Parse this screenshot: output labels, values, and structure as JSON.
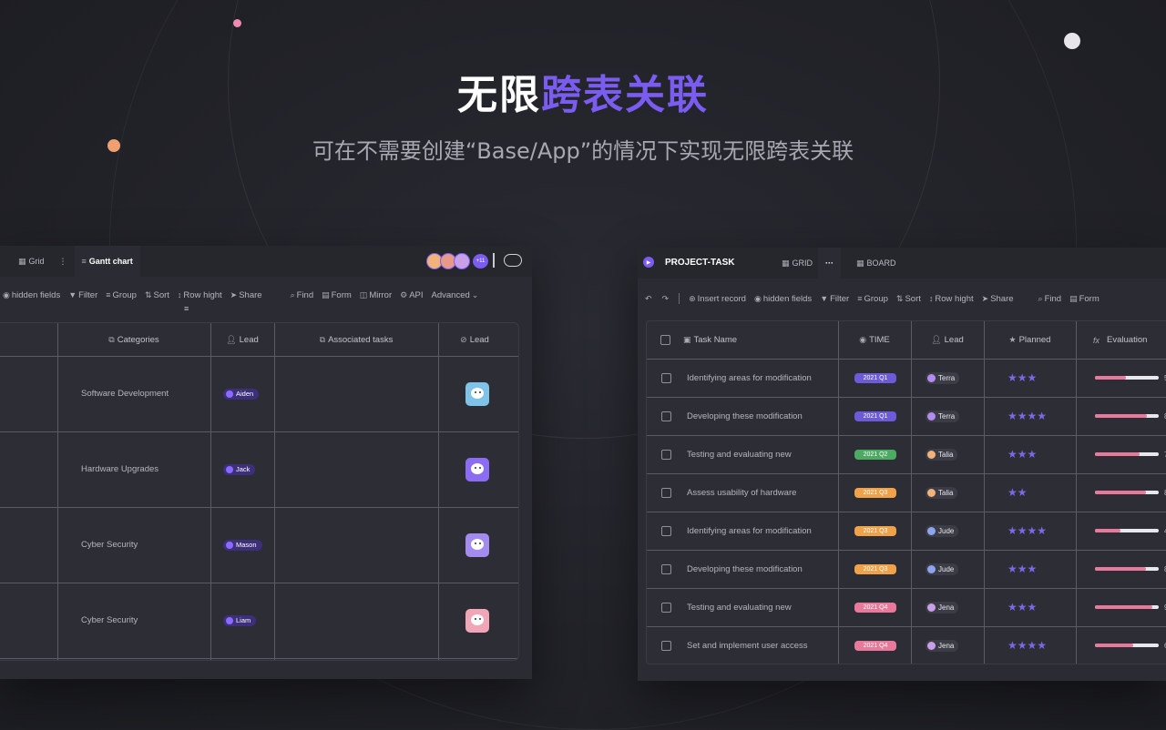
{
  "hero": {
    "title_white": "无限",
    "title_purple": "跨表关联",
    "subtitle": "可在不需要创建“Base/App”的情况下实现无限跨表关联"
  },
  "colors": {
    "accent": "#7b5cf0",
    "bg": "#222329",
    "panel": "#2b2c33",
    "star": "#7b67e8",
    "progress": "#e8799a"
  },
  "left": {
    "tabs": {
      "grid": "Grid",
      "more": "⋮",
      "gantt": "Gantt chart"
    },
    "avatar_count": "+11",
    "toolbar": {
      "hidden": "hidden fields",
      "filter": "Filter",
      "group": "Group",
      "sort": "Sort",
      "row_height": "Row hight",
      "share": "Share",
      "find": "Find",
      "form": "Form",
      "mirror": "Mirror",
      "api": "API",
      "advanced": "Advanced"
    },
    "columns": {
      "categories": "Categories",
      "lead": "Lead",
      "assoc": "Associated tasks",
      "lead2": "Lead"
    },
    "rows": [
      {
        "category": "Software Development",
        "lead": "Aiden",
        "tile": "#7fc3e8"
      },
      {
        "category": "Hardware Upgrades",
        "lead": "Jack",
        "tile": "#8b6cf2"
      },
      {
        "category": "Cyber Security",
        "lead": "Mason",
        "tile": "#a38bf0"
      },
      {
        "category": "Cyber Security",
        "lead": "Liam",
        "tile": "#f0a6b6"
      }
    ]
  },
  "right": {
    "title": "PROJECT-TASK",
    "tabs": {
      "grid": "GRID",
      "more": "···",
      "board": "BOARD"
    },
    "toolbar": {
      "insert": "Insert record",
      "hidden": "hidden fields",
      "filter": "Filter",
      "group": "Group",
      "sort": "Sort",
      "row_height": "Row hight",
      "share": "Share",
      "find": "Find",
      "form": "Form"
    },
    "columns": {
      "task": "Task Name",
      "time": "TIME",
      "lead": "Lead",
      "planned": "Planned",
      "eval": "Evaluation"
    },
    "rows": [
      {
        "task": "Identifying areas for modification",
        "time": "2021 Q1",
        "time_color": "#6c5ad8",
        "lead": "Terra",
        "lead_color": "#b48cf0",
        "stars": "★★★",
        "progress": 0.48,
        "eval": "5"
      },
      {
        "task": "Developing these modification",
        "time": "2021 Q1",
        "time_color": "#6c5ad8",
        "lead": "Terra",
        "lead_color": "#b48cf0",
        "stars": "★★★★",
        "progress": 0.82,
        "eval": "8"
      },
      {
        "task": "Testing and evaluating new",
        "time": "2021 Q2",
        "time_color": "#4caa63",
        "lead": "Talia",
        "lead_color": "#f2b37a",
        "stars": "★★★",
        "progress": 0.7,
        "eval": "7"
      },
      {
        "task": "Assess usability of hardware",
        "time": "2021 Q3",
        "time_color": "#f0a24a",
        "lead": "Talia",
        "lead_color": "#f2b37a",
        "stars": "★★",
        "progress": 0.8,
        "eval": "8"
      },
      {
        "task": "Identifying areas for modification",
        "time": "2021 Q3",
        "time_color": "#f0a24a",
        "lead": "Jude",
        "lead_color": "#8fa4f0",
        "stars": "★★★★",
        "progress": 0.4,
        "eval": "4"
      },
      {
        "task": "Developing these modification",
        "time": "2021 Q3",
        "time_color": "#f0a24a",
        "lead": "Jude",
        "lead_color": "#8fa4f0",
        "stars": "★★★",
        "progress": 0.8,
        "eval": "8"
      },
      {
        "task": "Testing and evaluating new",
        "time": "2021 Q4",
        "time_color": "#e8799a",
        "lead": "Jena",
        "lead_color": "#c9a0e8",
        "stars": "★★★",
        "progress": 0.9,
        "eval": "9"
      },
      {
        "task": "Set and implement user access",
        "time": "2021 Q4",
        "time_color": "#e8799a",
        "lead": "Jena",
        "lead_color": "#c9a0e8",
        "stars": "★★★★",
        "progress": 0.6,
        "eval": "6"
      }
    ]
  }
}
